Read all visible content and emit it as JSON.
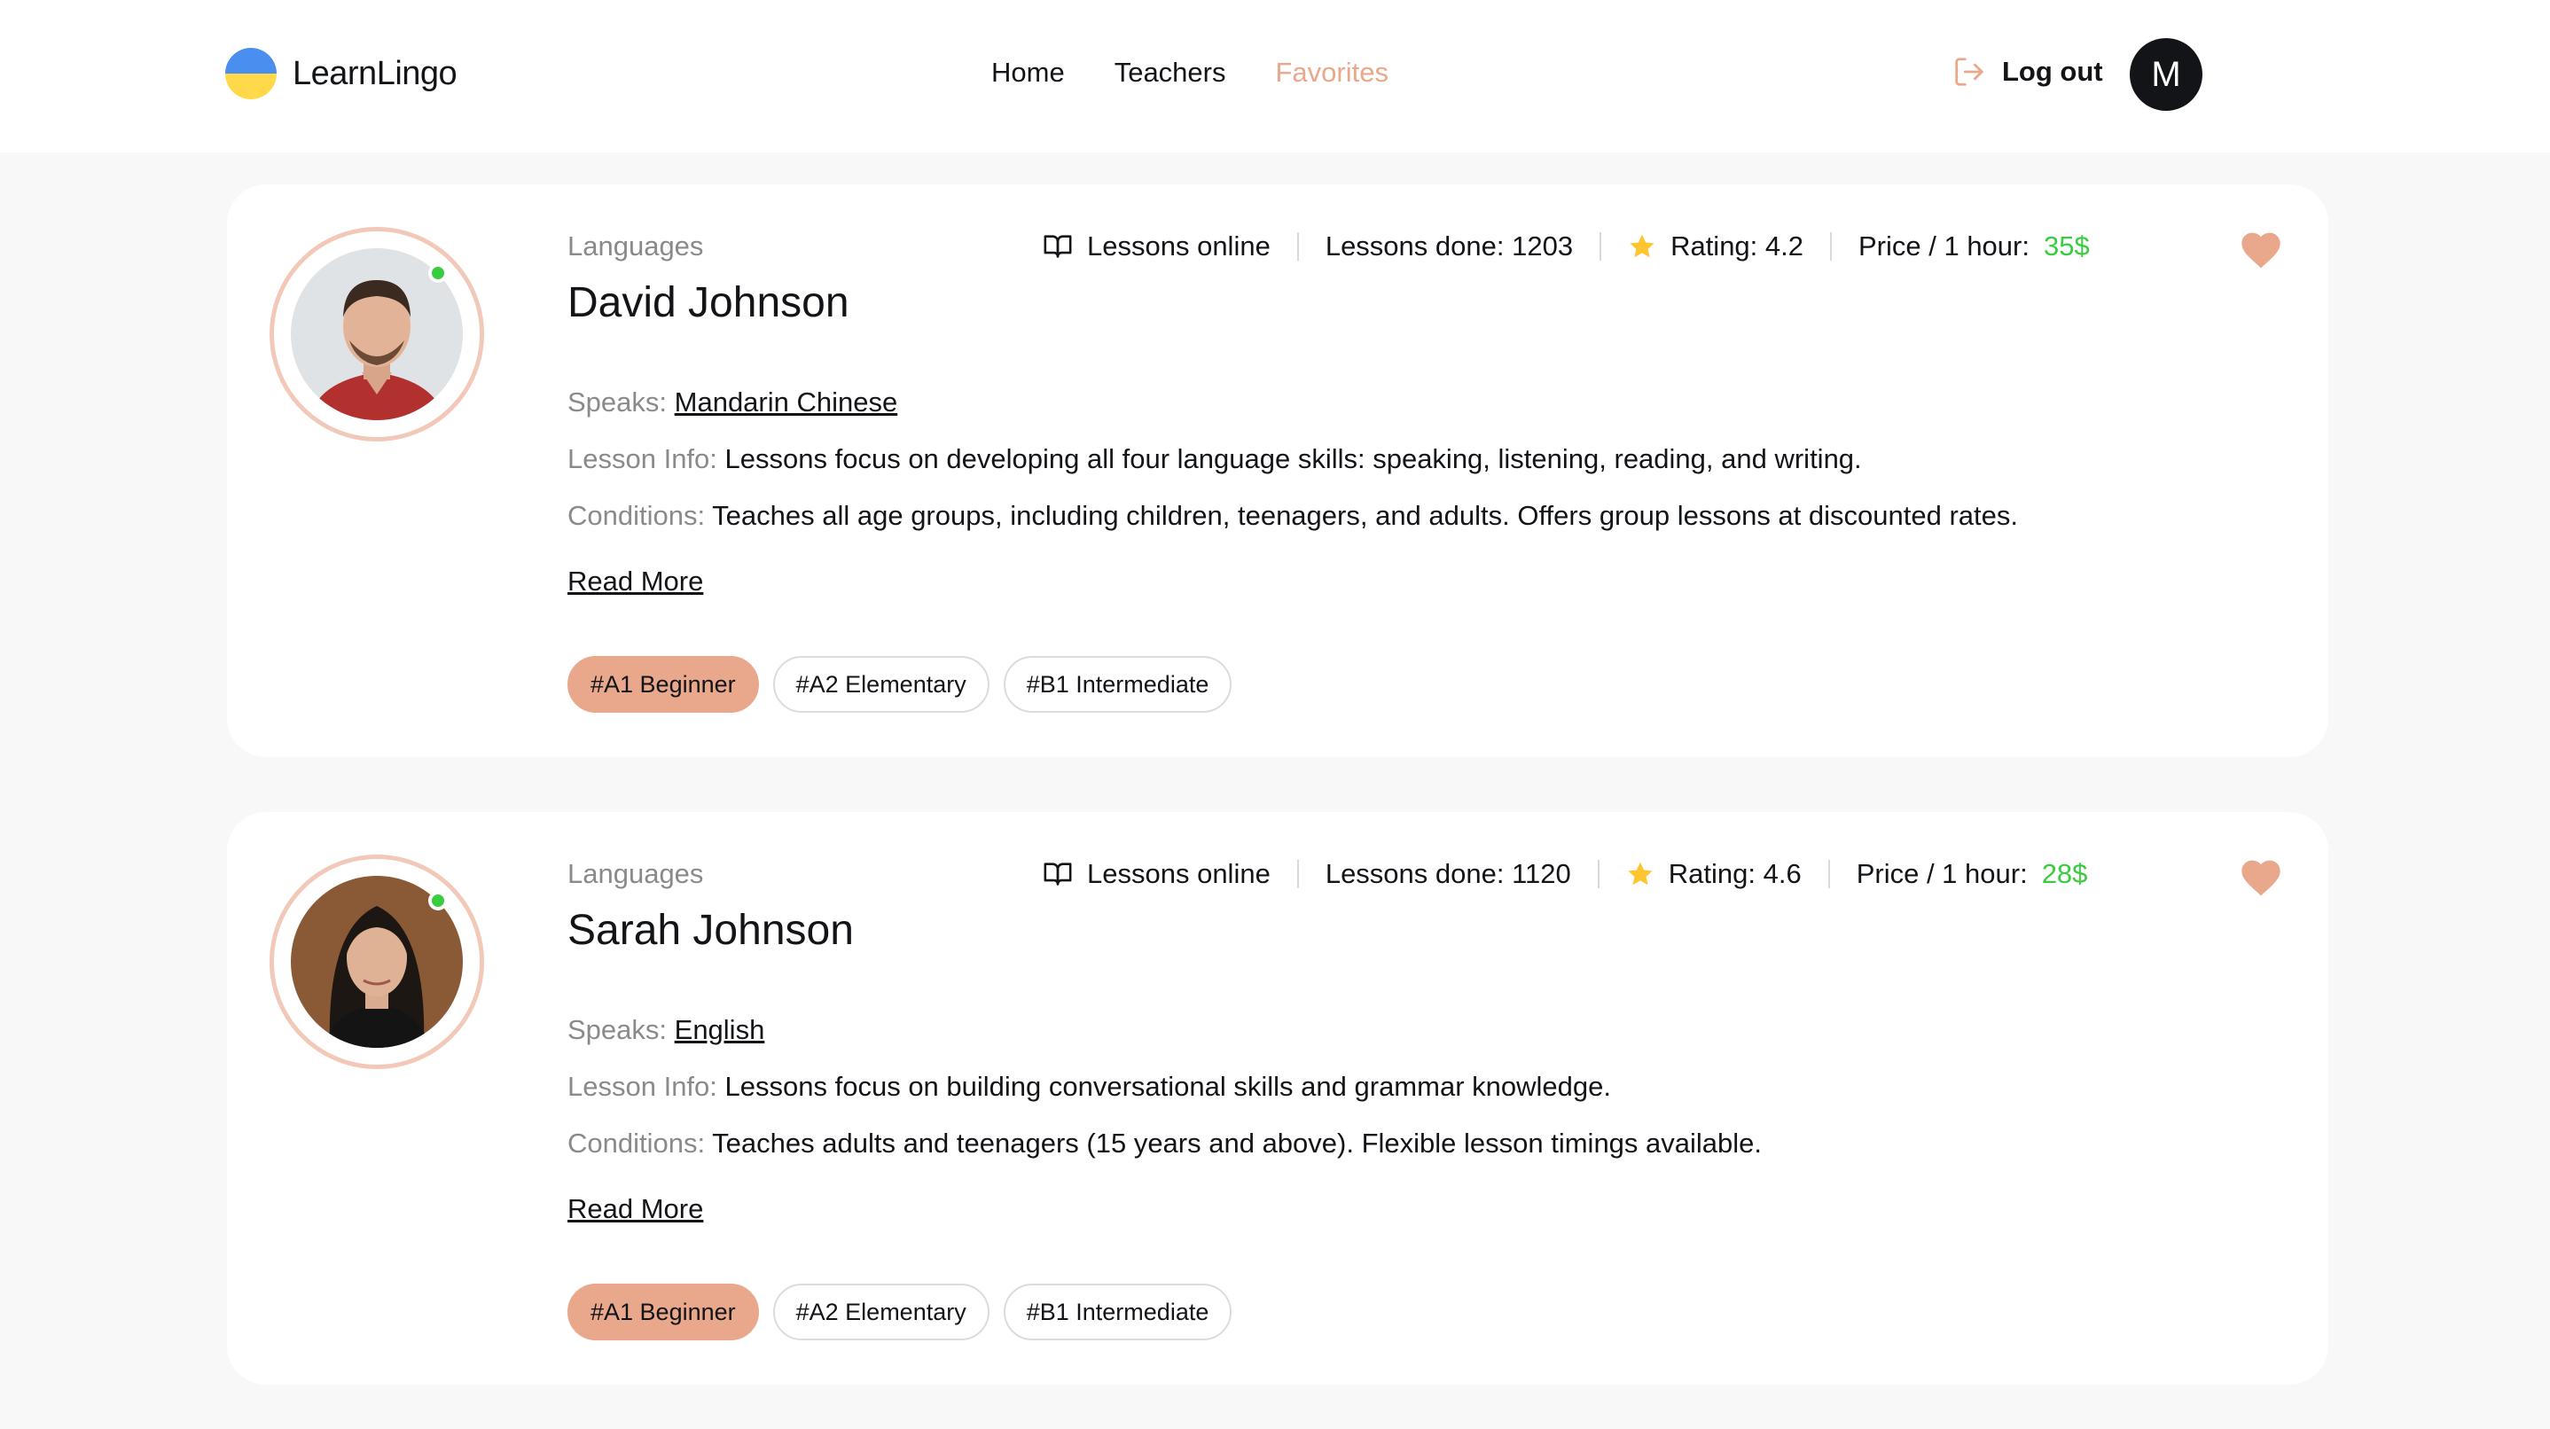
{
  "brand": {
    "name": "LearnLingo"
  },
  "nav": {
    "home": "Home",
    "teachers": "Teachers",
    "favorites": "Favorites"
  },
  "header": {
    "logout": "Log out",
    "avatar_letter": "M"
  },
  "accent_color": "#e9a88b",
  "teachers": [
    {
      "languages_label": "Languages",
      "name": "David Johnson",
      "lessons_online": "Lessons online",
      "lessons_done": "Lessons done: 1203",
      "rating": "Rating: 4.2",
      "price_label": "Price / 1 hour:",
      "price": "35$",
      "speaks_label": "Speaks:",
      "speaks": "Mandarin Chinese",
      "lesson_info_label": "Lesson Info:",
      "lesson_info": "Lessons focus on developing all four language skills: speaking, listening, reading, and writing.",
      "conditions_label": "Conditions:",
      "conditions": "Teaches all age groups, including children, teenagers, and adults. Offers group lessons at discounted rates.",
      "read_more": "Read More",
      "levels": [
        "#A1 Beginner",
        "#A2 Elementary",
        "#B1 Intermediate"
      ]
    },
    {
      "languages_label": "Languages",
      "name": "Sarah Johnson",
      "lessons_online": "Lessons online",
      "lessons_done": "Lessons done: 1120",
      "rating": "Rating: 4.6",
      "price_label": "Price / 1 hour:",
      "price": "28$",
      "speaks_label": "Speaks:",
      "speaks": "English",
      "lesson_info_label": "Lesson Info:",
      "lesson_info": "Lessons focus on building conversational skills and grammar knowledge.",
      "conditions_label": "Conditions:",
      "conditions": "Teaches adults and teenagers (15 years and above). Flexible lesson timings available.",
      "read_more": "Read More",
      "levels": [
        "#A1 Beginner",
        "#A2 Elementary",
        "#B1 Intermediate"
      ]
    }
  ]
}
